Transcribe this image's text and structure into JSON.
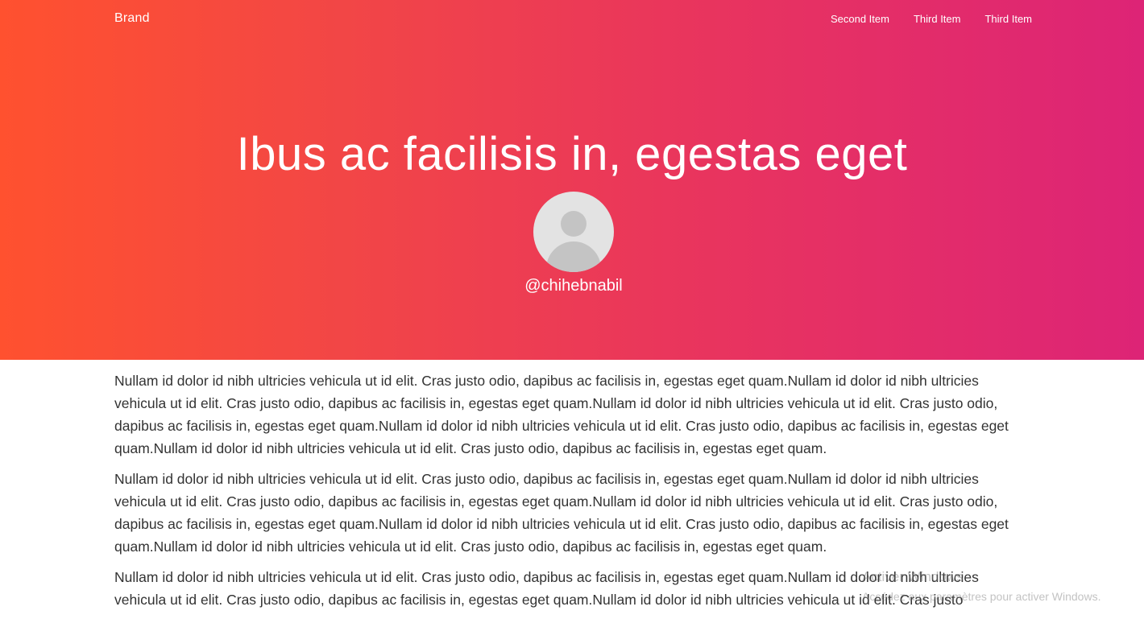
{
  "navbar": {
    "brand": "Brand",
    "items": [
      {
        "label": "Second Item"
      },
      {
        "label": "Third Item"
      },
      {
        "label": "Third Item"
      }
    ]
  },
  "hero": {
    "title": "Ibus ac facilisis in, egestas eget",
    "avatar_icon": "user-avatar-placeholder",
    "username": "@chihebnabil"
  },
  "content": {
    "paragraphs": [
      "Nullam id dolor id nibh ultricies vehicula ut id elit. Cras justo odio, dapibus ac facilisis in, egestas eget quam.Nullam id dolor id nibh ultricies vehicula ut id elit. Cras justo odio, dapibus ac facilisis in, egestas eget quam.Nullam id dolor id nibh ultricies vehicula ut id elit. Cras justo odio, dapibus ac facilisis in, egestas eget quam.Nullam id dolor id nibh ultricies vehicula ut id elit. Cras justo odio, dapibus ac facilisis in, egestas eget quam.Nullam id dolor id nibh ultricies vehicula ut id elit. Cras justo odio, dapibus ac facilisis in, egestas eget quam.",
      "Nullam id dolor id nibh ultricies vehicula ut id elit. Cras justo odio, dapibus ac facilisis in, egestas eget quam.Nullam id dolor id nibh ultricies vehicula ut id elit. Cras justo odio, dapibus ac facilisis in, egestas eget quam.Nullam id dolor id nibh ultricies vehicula ut id elit. Cras justo odio, dapibus ac facilisis in, egestas eget quam.Nullam id dolor id nibh ultricies vehicula ut id elit. Cras justo odio, dapibus ac facilisis in, egestas eget quam.Nullam id dolor id nibh ultricies vehicula ut id elit. Cras justo odio, dapibus ac facilisis in, egestas eget quam.",
      "Nullam id dolor id nibh ultricies vehicula ut id elit. Cras justo odio, dapibus ac facilisis in, egestas eget quam.Nullam id dolor id nibh ultricies vehicula ut id elit. Cras justo odio, dapibus ac facilisis in, egestas eget quam.Nullam id dolor id nibh ultricies vehicula ut id elit. Cras justo"
    ]
  },
  "watermark": {
    "title": "Activer Windows",
    "subtitle": "Accédez aux paramètres pour activer Windows."
  },
  "colors": {
    "gradient_start": "#ff512f",
    "gradient_end": "#dd2476",
    "body_text": "#333333"
  }
}
